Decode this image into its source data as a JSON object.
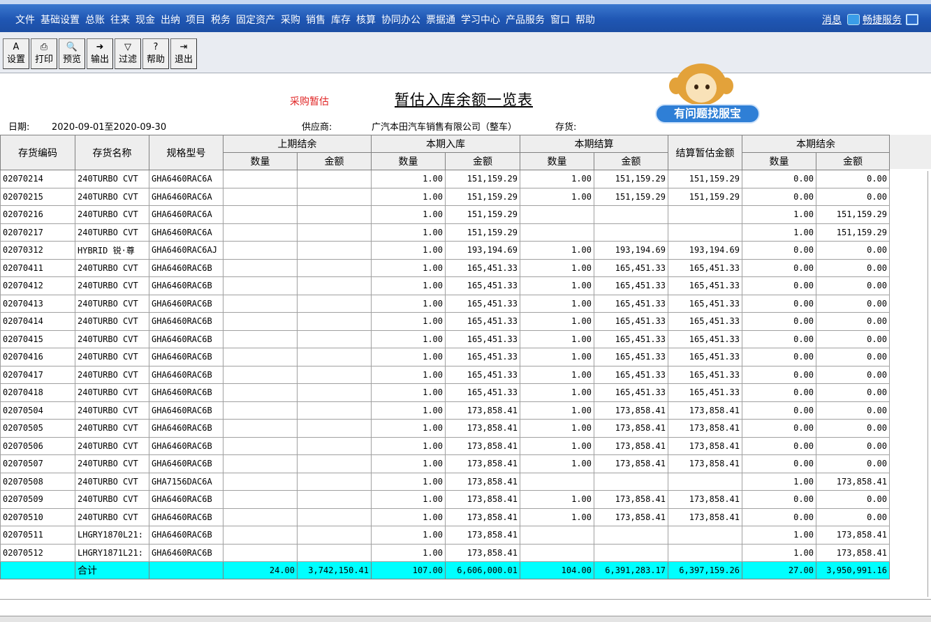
{
  "menu": {
    "items": [
      "文件",
      "基础设置",
      "总账",
      "往来",
      "现金",
      "出纳",
      "项目",
      "税务",
      "固定资产",
      "采购",
      "销售",
      "库存",
      "核算",
      "协同办公",
      "票据通",
      "学习中心",
      "产品服务",
      "窗口",
      "帮助"
    ],
    "info_label": "消息",
    "service_label": "畅捷服务"
  },
  "toolbar": {
    "buttons": [
      {
        "label": "设置",
        "icon": "settings-icon",
        "glyph": "A"
      },
      {
        "label": "打印",
        "icon": "printer-icon",
        "glyph": "⎙"
      },
      {
        "label": "预览",
        "icon": "preview-icon",
        "glyph": "🔍"
      },
      {
        "label": "输出",
        "icon": "export-icon",
        "glyph": "➜"
      },
      {
        "label": "过滤",
        "icon": "filter-icon",
        "glyph": "▽"
      },
      {
        "label": "帮助",
        "icon": "help-icon",
        "glyph": "?"
      },
      {
        "label": "退出",
        "icon": "exit-icon",
        "glyph": "⇥"
      }
    ]
  },
  "report": {
    "subtitle": "采购暂估",
    "title": "暂估入库余额一览表",
    "date_label": "日期:",
    "date_value": "2020-09-01至2020-09-30",
    "supplier_label": "供应商:",
    "supplier_value": "广汽本田汽车销售有限公司（整车）",
    "inventory_label": "存货:",
    "help_badge": "有问题找服宝"
  },
  "table": {
    "headers": {
      "code": "存货编码",
      "name": "存货名称",
      "spec": "规格型号",
      "prev": "上期结余",
      "in": "本期入库",
      "settle": "本期结算",
      "settle_amount": "结算暂估金额",
      "end": "本期结余",
      "qty": "数量",
      "amount": "金额"
    },
    "rows": [
      [
        "02070214",
        "240TURBO CVT",
        "GHA6460RAC6A",
        "",
        "",
        "1.00",
        "151,159.29",
        "1.00",
        "151,159.29",
        "151,159.29",
        "0.00",
        "0.00"
      ],
      [
        "02070215",
        "240TURBO CVT",
        "GHA6460RAC6A",
        "",
        "",
        "1.00",
        "151,159.29",
        "1.00",
        "151,159.29",
        "151,159.29",
        "0.00",
        "0.00"
      ],
      [
        "02070216",
        "240TURBO CVT",
        "GHA6460RAC6A",
        "",
        "",
        "1.00",
        "151,159.29",
        "",
        "",
        "",
        "1.00",
        "151,159.29"
      ],
      [
        "02070217",
        "240TURBO CVT",
        "GHA6460RAC6A",
        "",
        "",
        "1.00",
        "151,159.29",
        "",
        "",
        "",
        "1.00",
        "151,159.29"
      ],
      [
        "02070312",
        "HYBRID 锐·尊",
        "GHA6460RAC6AJ",
        "",
        "",
        "1.00",
        "193,194.69",
        "1.00",
        "193,194.69",
        "193,194.69",
        "0.00",
        "0.00"
      ],
      [
        "02070411",
        "240TURBO CVT",
        "GHA6460RAC6B",
        "",
        "",
        "1.00",
        "165,451.33",
        "1.00",
        "165,451.33",
        "165,451.33",
        "0.00",
        "0.00"
      ],
      [
        "02070412",
        "240TURBO CVT",
        "GHA6460RAC6B",
        "",
        "",
        "1.00",
        "165,451.33",
        "1.00",
        "165,451.33",
        "165,451.33",
        "0.00",
        "0.00"
      ],
      [
        "02070413",
        "240TURBO CVT",
        "GHA6460RAC6B",
        "",
        "",
        "1.00",
        "165,451.33",
        "1.00",
        "165,451.33",
        "165,451.33",
        "0.00",
        "0.00"
      ],
      [
        "02070414",
        "240TURBO CVT",
        "GHA6460RAC6B",
        "",
        "",
        "1.00",
        "165,451.33",
        "1.00",
        "165,451.33",
        "165,451.33",
        "0.00",
        "0.00"
      ],
      [
        "02070415",
        "240TURBO CVT",
        "GHA6460RAC6B",
        "",
        "",
        "1.00",
        "165,451.33",
        "1.00",
        "165,451.33",
        "165,451.33",
        "0.00",
        "0.00"
      ],
      [
        "02070416",
        "240TURBO CVT",
        "GHA6460RAC6B",
        "",
        "",
        "1.00",
        "165,451.33",
        "1.00",
        "165,451.33",
        "165,451.33",
        "0.00",
        "0.00"
      ],
      [
        "02070417",
        "240TURBO CVT",
        "GHA6460RAC6B",
        "",
        "",
        "1.00",
        "165,451.33",
        "1.00",
        "165,451.33",
        "165,451.33",
        "0.00",
        "0.00"
      ],
      [
        "02070418",
        "240TURBO CVT",
        "GHA6460RAC6B",
        "",
        "",
        "1.00",
        "165,451.33",
        "1.00",
        "165,451.33",
        "165,451.33",
        "0.00",
        "0.00"
      ],
      [
        "02070504",
        "240TURBO CVT",
        "GHA6460RAC6B",
        "",
        "",
        "1.00",
        "173,858.41",
        "1.00",
        "173,858.41",
        "173,858.41",
        "0.00",
        "0.00"
      ],
      [
        "02070505",
        "240TURBO CVT",
        "GHA6460RAC6B",
        "",
        "",
        "1.00",
        "173,858.41",
        "1.00",
        "173,858.41",
        "173,858.41",
        "0.00",
        "0.00"
      ],
      [
        "02070506",
        "240TURBO CVT",
        "GHA6460RAC6B",
        "",
        "",
        "1.00",
        "173,858.41",
        "1.00",
        "173,858.41",
        "173,858.41",
        "0.00",
        "0.00"
      ],
      [
        "02070507",
        "240TURBO CVT",
        "GHA6460RAC6B",
        "",
        "",
        "1.00",
        "173,858.41",
        "1.00",
        "173,858.41",
        "173,858.41",
        "0.00",
        "0.00"
      ],
      [
        "02070508",
        "240TURBO CVT",
        "GHA7156DAC6A",
        "",
        "",
        "1.00",
        "173,858.41",
        "",
        "",
        "",
        "1.00",
        "173,858.41"
      ],
      [
        "02070509",
        "240TURBO CVT",
        "GHA6460RAC6B",
        "",
        "",
        "1.00",
        "173,858.41",
        "1.00",
        "173,858.41",
        "173,858.41",
        "0.00",
        "0.00"
      ],
      [
        "02070510",
        "240TURBO CVT",
        "GHA6460RAC6B",
        "",
        "",
        "1.00",
        "173,858.41",
        "1.00",
        "173,858.41",
        "173,858.41",
        "0.00",
        "0.00"
      ],
      [
        "02070511",
        "LHGRY1870L21:",
        "GHA6460RAC6B",
        "",
        "",
        "1.00",
        "173,858.41",
        "",
        "",
        "",
        "1.00",
        "173,858.41"
      ],
      [
        "02070512",
        "LHGRY1871L21:",
        "GHA6460RAC6B",
        "",
        "",
        "1.00",
        "173,858.41",
        "",
        "",
        "",
        "1.00",
        "173,858.41"
      ]
    ],
    "total": [
      "",
      "合计",
      "",
      "24.00",
      "3,742,150.41",
      "107.00",
      "6,606,000.01",
      "104.00",
      "6,391,283.17",
      "6,397,159.26",
      "27.00",
      "3,950,991.16"
    ]
  }
}
